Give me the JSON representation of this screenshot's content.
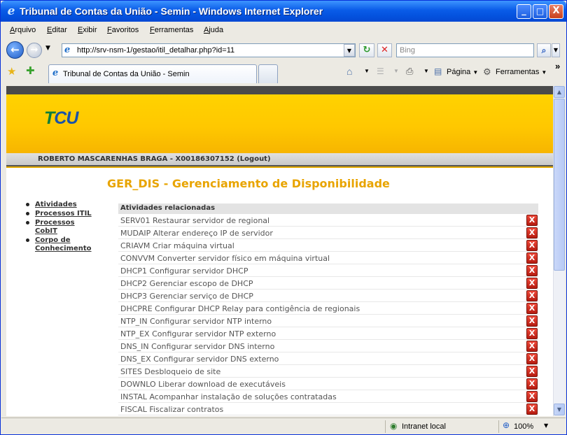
{
  "window": {
    "title": "Tribunal de Contas da União - Semin - Windows Internet Explorer",
    "minimize": "_",
    "maximize": "□",
    "close": "X"
  },
  "menubar": {
    "items": [
      {
        "key": "A",
        "rest": "rquivo"
      },
      {
        "key": "E",
        "rest": "ditar"
      },
      {
        "key": "E",
        "rest": "xibir"
      },
      {
        "key": "F",
        "rest": "avoritos"
      },
      {
        "key": "F",
        "rest": "erramentas"
      },
      {
        "key": "A",
        "rest": "juda"
      }
    ]
  },
  "navbar": {
    "back_icon": "back-arrow-icon",
    "forward_icon": "forward-arrow-icon",
    "address": "http://srv-nsm-1/gestao/itil_detalhar.php?id=11",
    "search_placeholder": "Bing"
  },
  "tabs": [
    {
      "label": "Tribunal de Contas da União - Semin"
    }
  ],
  "toolbar": {
    "pagina": "Página",
    "ferramentas": "Ferramentas",
    "more": "»"
  },
  "page": {
    "logo": {
      "t": "T",
      "cu": "CU"
    },
    "user": "ROBERTO MASCARENHAS BRAGA - X00186307152 (Logout)",
    "heading": "GER_DIS - Gerenciamento de Disponibilidade",
    "nav": [
      "Atividades",
      "Processos ITIL",
      "Processos CobIT",
      "Corpo de Conhecimento"
    ],
    "activities_header": "Atividades relacionadas",
    "activities": [
      "SERV01 Restaurar servidor de regional",
      "MUDAIP Alterar endereço IP de servidor",
      "CRIAVM Criar máquina virtual",
      "CONVVM Converter servidor físico em máquina virtual",
      "DHCP1 Configurar servidor DHCP",
      "DHCP2 Gerenciar escopo de DHCP",
      "DHCP3 Gerenciar serviço de DHCP",
      "DHCPRE Configurar DHCP Relay para contigência de regionais",
      "NTP_IN Configurar servidor NTP interno",
      "NTP_EX Configurar servidor NTP externo",
      "DNS_IN Configurar servidor DNS interno",
      "DNS_EX Configurar servidor DNS externo",
      "SITES Desbloqueio de site",
      "DOWNLO Liberar download de executáveis",
      "INSTAL Acompanhar instalação de soluções contratadas",
      "FISCAL Fiscalizar contratos"
    ],
    "delete_label": "X"
  },
  "statusbar": {
    "zone": "Intranet local",
    "zoom": "100%"
  }
}
